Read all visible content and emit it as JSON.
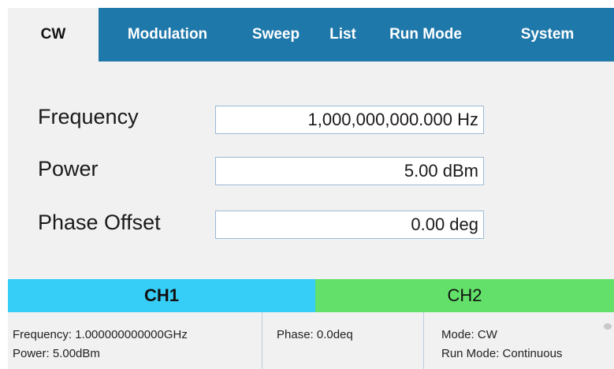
{
  "tabs": [
    {
      "label": "CW",
      "active": true
    },
    {
      "label": "Modulation",
      "active": false
    },
    {
      "label": "Sweep",
      "active": false
    },
    {
      "label": "List",
      "active": false
    },
    {
      "label": "Run Mode",
      "active": false
    },
    {
      "label": "System",
      "active": false
    }
  ],
  "fields": {
    "frequency": {
      "label": "Frequency",
      "value": "1,000,000,000.000 Hz"
    },
    "power": {
      "label": "Power",
      "value": "5.00 dBm"
    },
    "phase_offset": {
      "label": "Phase Offset",
      "value": "0.00 deg"
    }
  },
  "channels": {
    "ch1": {
      "label": "CH1",
      "color": "#36cdf6",
      "selected": true
    },
    "ch2": {
      "label": "CH2",
      "color": "#63e06a",
      "selected": false
    }
  },
  "status": {
    "frequency": "Frequency: 1.000000000000GHz",
    "power": "Power: 5.00dBm",
    "phase": "Phase: 0.0deq",
    "mode": "Mode: CW",
    "run_mode": "Run Mode: Continuous"
  },
  "colors": {
    "tab_bar": "#1f78aa",
    "panel_bg": "#f1f1f1",
    "input_border": "#9ab9d6"
  }
}
